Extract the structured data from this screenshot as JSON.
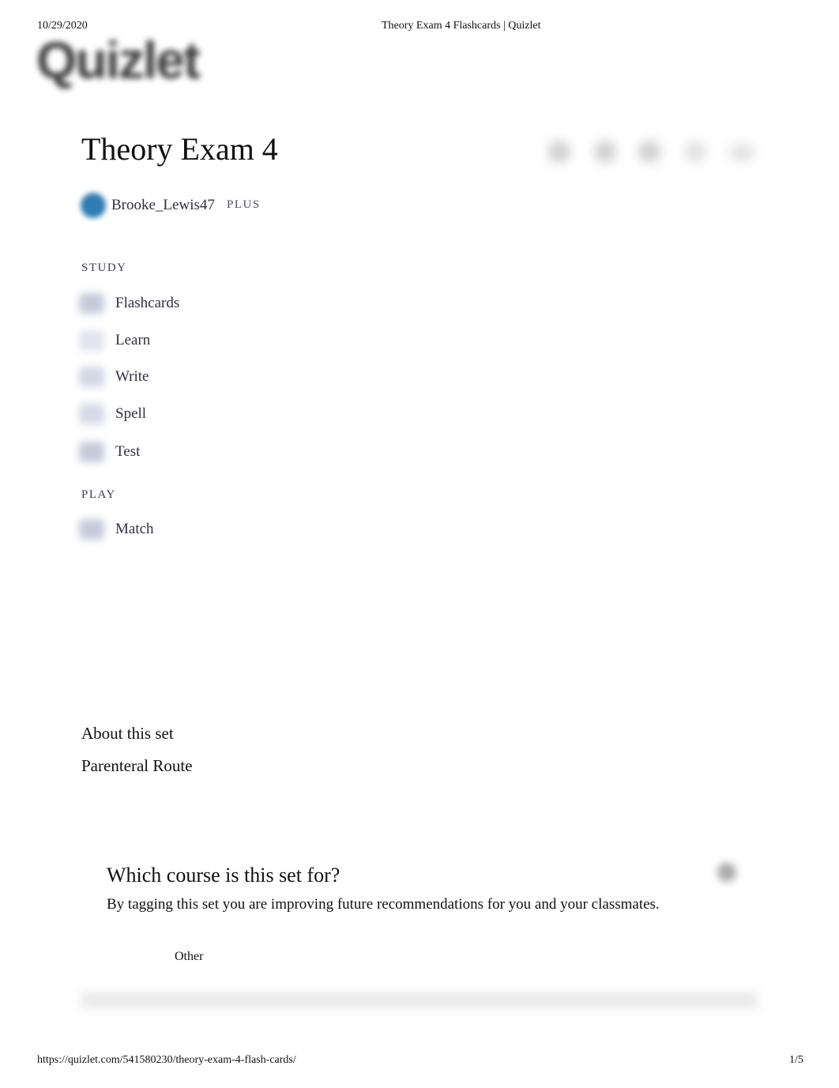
{
  "print_header": {
    "date": "10/29/2020",
    "page_title": "Theory Exam 4 Flashcards | Quizlet"
  },
  "logo": {
    "text": "Quizlet",
    "icon": "quizlet-logo"
  },
  "set": {
    "title": "Theory Exam 4",
    "author": "Brooke_Lewis47",
    "author_badge": "PLUS",
    "avatar_color": "#2f7bb3"
  },
  "toolbar": {
    "icons": [
      "add-to-folder-icon",
      "share-link-icon",
      "info-icon",
      "edit-icon",
      "more-options-icon"
    ]
  },
  "study": {
    "label": "STUDY",
    "modes": [
      {
        "label": "Flashcards",
        "icon": "flashcards-icon"
      },
      {
        "label": "Learn",
        "icon": "learn-icon"
      },
      {
        "label": "Write",
        "icon": "write-icon"
      },
      {
        "label": "Spell",
        "icon": "spell-icon"
      },
      {
        "label": "Test",
        "icon": "test-icon"
      }
    ]
  },
  "play": {
    "label": "PLAY",
    "modes": [
      {
        "label": "Match",
        "icon": "match-icon"
      }
    ]
  },
  "about": {
    "title": "About this set",
    "description": "Parenteral Route"
  },
  "course_prompt": {
    "heading": "Which course is this set for?",
    "description": "By tagging this set you are improving future recommendations for you and your classmates.",
    "option": "Other"
  },
  "print_footer": {
    "url": "https://quizlet.com/541580230/theory-exam-4-flash-cards/",
    "page": "1/5"
  }
}
